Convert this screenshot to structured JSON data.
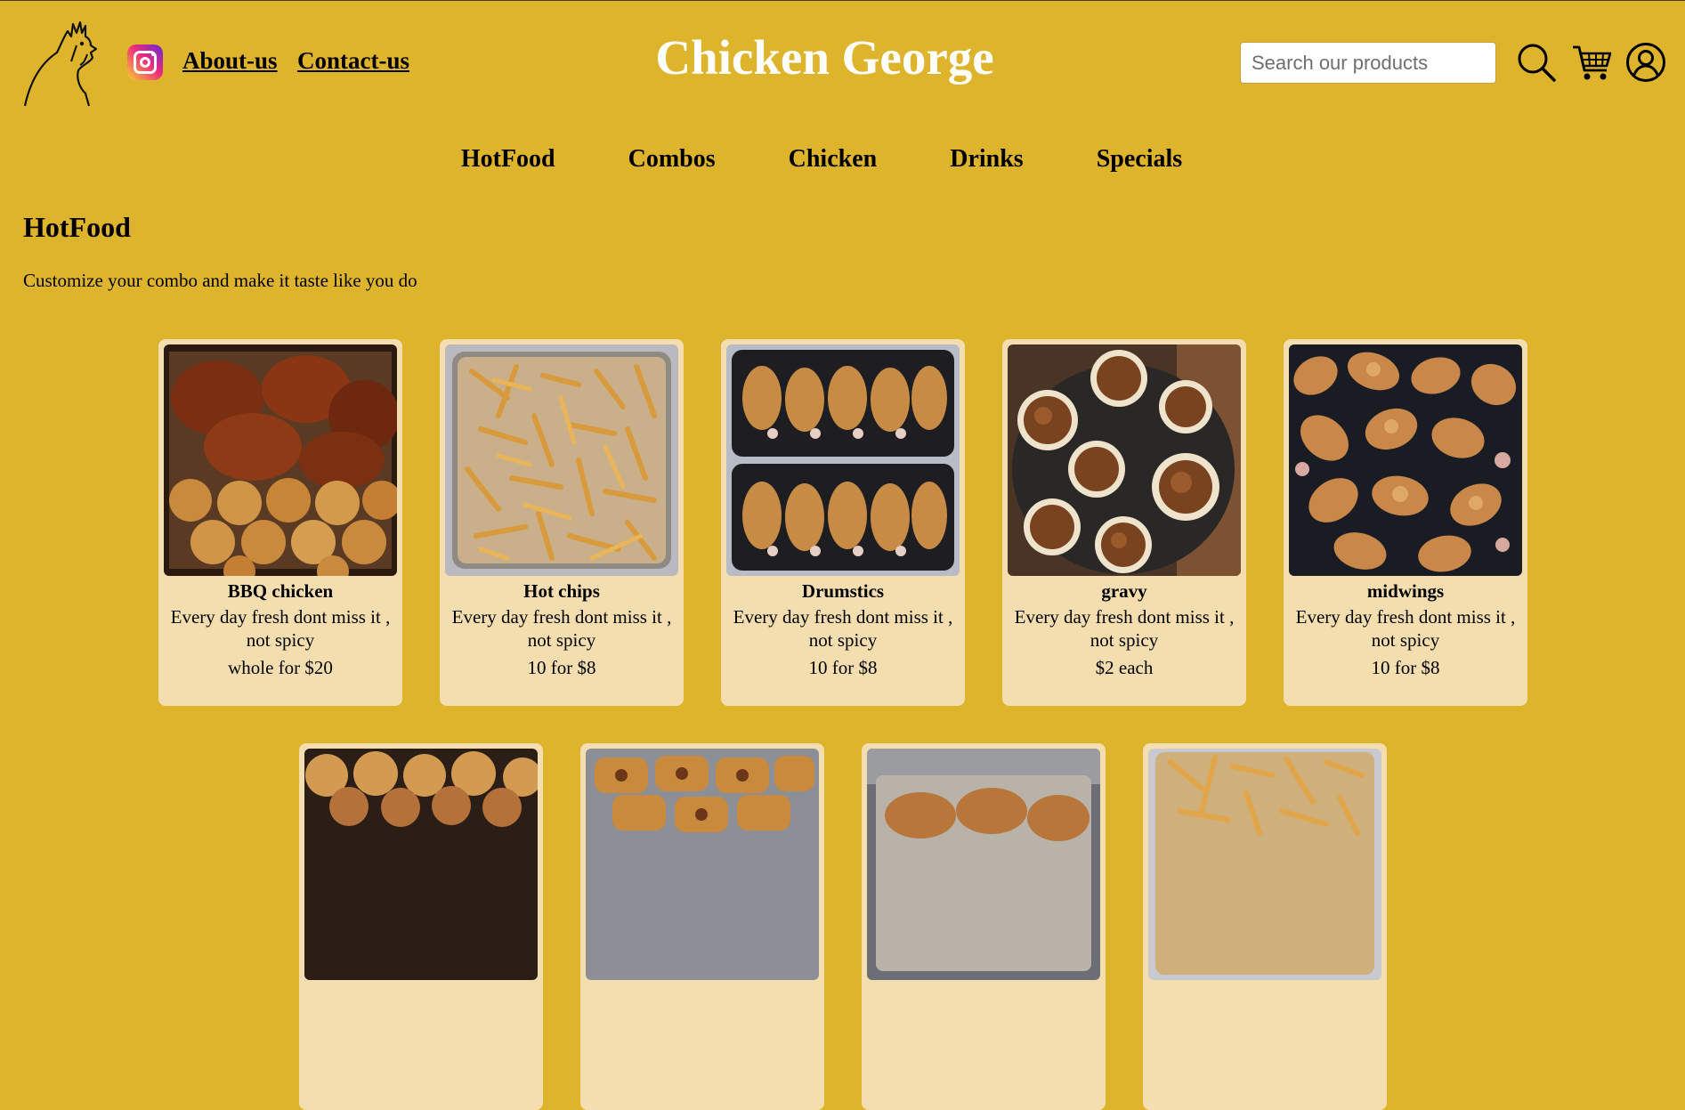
{
  "brand": "Chicken George",
  "header": {
    "about_label": "About-us",
    "contact_label": "Contact-us",
    "search_placeholder": "Search our products",
    "icons": [
      "rooster-logo-icon",
      "instagram-icon",
      "search-icon",
      "cart-icon",
      "user-icon"
    ]
  },
  "nav": {
    "items": [
      "HotFood",
      "Combos",
      "Chicken",
      "Drinks",
      "Specials"
    ]
  },
  "section": {
    "title": "HotFood",
    "description": "Customize your combo and make it taste like you do"
  },
  "products": [
    {
      "name": "BBQ chicken",
      "description": "Every day fresh dont miss it , not spicy",
      "price": "whole for $20",
      "image": "bbq-chicken-photo"
    },
    {
      "name": "Hot chips",
      "description": "Every day fresh dont miss it , not spicy",
      "price": "10 for $8",
      "image": "hot-chips-photo"
    },
    {
      "name": "Drumstics",
      "description": "Every day fresh dont miss it , not spicy",
      "price": "10 for $8",
      "image": "drumsticks-photo"
    },
    {
      "name": "gravy",
      "description": "Every day fresh dont miss it , not spicy",
      "price": "$2 each",
      "image": "gravy-photo"
    },
    {
      "name": "midwings",
      "description": "Every day fresh dont miss it , not spicy",
      "price": "10 for $8",
      "image": "midwings-photo"
    }
  ],
  "products_row2": [
    {
      "image": "rolls-photo"
    },
    {
      "image": "sausage-rolls-photo"
    },
    {
      "image": "fried-chicken-tray-photo"
    },
    {
      "image": "chips-tray-photo"
    }
  ],
  "colors": {
    "background": "#dfb42d",
    "card": "#f4deb0",
    "brand_text": "#ffffff"
  }
}
